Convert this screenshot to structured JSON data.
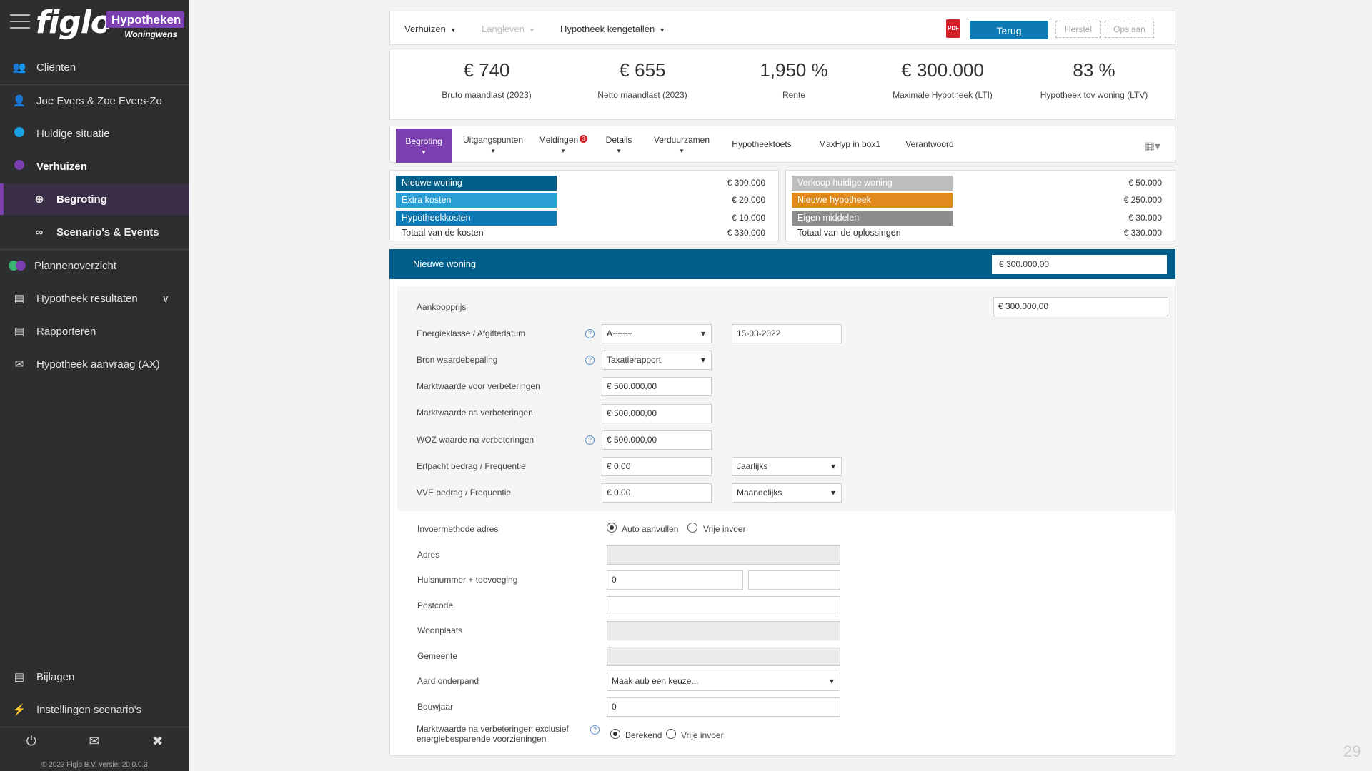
{
  "brand": {
    "logo": "figlo",
    "product": "Hypotheken",
    "subtitle": "Woningwens"
  },
  "sidebar": {
    "items": [
      {
        "label": "Cliënten",
        "icon": "users-icon"
      },
      {
        "label": "Joe Evers & Zoe Evers-Zo",
        "icon": "user-icon"
      },
      {
        "label": "Huidige situatie",
        "icon": "blue-dot-icon"
      },
      {
        "label": "Verhuizen",
        "icon": "purple-dot-icon"
      },
      {
        "label": "Begroting",
        "icon": "crosshair-icon"
      },
      {
        "label": "Scenario's & Events",
        "icon": "glasses-icon"
      },
      {
        "label": "Plannenoverzicht",
        "icon": "two-dots-icon"
      },
      {
        "label": "Hypotheek resultaten",
        "icon": "chart-icon"
      },
      {
        "label": "Rapporteren",
        "icon": "document-icon"
      },
      {
        "label": "Hypotheek aanvraag (AX)",
        "icon": "envelope-open-icon"
      },
      {
        "label": "Bijlagen",
        "icon": "file-icon"
      },
      {
        "label": "Instellingen scenario's",
        "icon": "bolt-icon"
      }
    ],
    "footer": "© 2023 Figlo B.V. versie: 20.0.0.3"
  },
  "topbar": {
    "menu1": "Verhuizen",
    "menu2": "Langleven",
    "menu3": "Hypotheek kengetallen",
    "pdf": "PDF",
    "terug": "Terug",
    "herstel": "Herstel",
    "opslaan": "Opslaan"
  },
  "kpis": [
    {
      "value": "€ 740",
      "label": "Bruto maandlast (2023)"
    },
    {
      "value": "€ 655",
      "label": "Netto maandlast (2023)"
    },
    {
      "value": "1,950 %",
      "label": "Rente"
    },
    {
      "value": "€ 300.000",
      "label": "Maximale Hypotheek (LTI)"
    },
    {
      "value": "83 %",
      "label": "Hypotheek tov woning (LTV)"
    }
  ],
  "tabs": [
    "Begroting",
    "Uitgangspunten",
    "Meldingen",
    "Details",
    "Verduurzamen",
    "Hypotheektoets",
    "MaxHyp in box1",
    "Verantwoord"
  ],
  "meldingen_count": "3",
  "costs": {
    "rows": [
      {
        "label": "Nieuwe woning",
        "value": "€ 300.000",
        "color": "#005e8a"
      },
      {
        "label": "Extra kosten",
        "value": "€ 20.000",
        "color": "#2a9fd6"
      },
      {
        "label": "Hypotheekkosten",
        "value": "€ 10.000",
        "color": "#0d7ab5"
      }
    ],
    "total_label": "Totaal van de kosten",
    "total_value": "€ 330.000"
  },
  "solutions": {
    "rows": [
      {
        "label": "Verkoop huidige woning",
        "value": "€ 50.000",
        "color": "#bdbdbd"
      },
      {
        "label": "Nieuwe hypotheek",
        "value": "€ 250.000",
        "color": "#e08a1e"
      },
      {
        "label": "Eigen middelen",
        "value": "€ 30.000",
        "color": "#8d8d8d"
      }
    ],
    "total_label": "Totaal van de oplossingen",
    "total_value": "€ 330.000"
  },
  "section": {
    "title": "Nieuwe woning",
    "value": "€ 300.000,00"
  },
  "form": {
    "aankoopprijs": {
      "label": "Aankoopprijs",
      "value": "€ 300.000,00"
    },
    "energie": {
      "label": "Energieklasse / Afgiftedatum",
      "value": "A++++",
      "date": "15-03-2022"
    },
    "bron": {
      "label": "Bron waardebepaling",
      "value": "Taxatierapport"
    },
    "mw_voor": {
      "label": "Marktwaarde voor verbeteringen",
      "value": "€  500.000,00"
    },
    "mw_na": {
      "label": "Marktwaarde na verbeteringen",
      "value": "€  500.000,00"
    },
    "woz": {
      "label": "WOZ waarde na verbeteringen",
      "value": "€  500.000,00"
    },
    "erfpacht": {
      "label": "Erfpacht bedrag / Frequentie",
      "value": "€  0,00",
      "freq": "Jaarlijks"
    },
    "vve": {
      "label": "VVE bedrag / Frequentie",
      "value": "€  0,00",
      "freq": "Maandelijks"
    },
    "invoermethode": {
      "label": "Invoermethode adres",
      "opt1": "Auto aanvullen",
      "opt2": "Vrije invoer"
    },
    "adres": {
      "label": "Adres",
      "value": ""
    },
    "huisnummer": {
      "label": "Huisnummer + toevoeging",
      "value": "0",
      "toevoeging": ""
    },
    "postcode": {
      "label": "Postcode",
      "value": ""
    },
    "woonplaats": {
      "label": "Woonplaats",
      "value": ""
    },
    "gemeente": {
      "label": "Gemeente",
      "value": ""
    },
    "aard": {
      "label": "Aard onderpand",
      "value": "Maak aub een keuze..."
    },
    "bouwjaar": {
      "label": "Bouwjaar",
      "value": "0"
    },
    "mw_excl": {
      "label_line1": "Marktwaarde na verbeteringen exclusief",
      "label_line2": "energiebesparende voorzieningen",
      "opt1": "Berekend",
      "opt2": "Vrije invoer"
    }
  },
  "page_number": "29"
}
